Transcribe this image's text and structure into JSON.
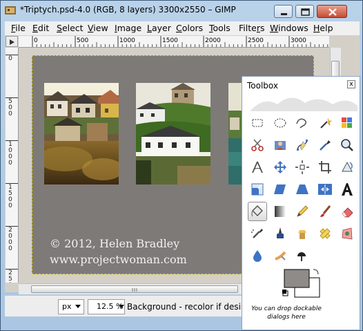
{
  "window": {
    "title": "*Triptych.psd-4.0 (RGB, 8 layers) 3300x2550 – GIMP",
    "buttons": [
      "minimize",
      "maximize",
      "close"
    ]
  },
  "menu": [
    {
      "label": "File",
      "accel": "F",
      "rest": "ile"
    },
    {
      "label": "Edit",
      "accel": "E",
      "rest": "dit"
    },
    {
      "label": "Select",
      "accel": "S",
      "rest": "elect"
    },
    {
      "label": "View",
      "accel": "V",
      "rest": "iew"
    },
    {
      "label": "Image",
      "accel": "I",
      "rest": "mage"
    },
    {
      "label": "Layer",
      "accel": "L",
      "rest": "ayer"
    },
    {
      "label": "Colors",
      "accel": "C",
      "rest": "olors"
    },
    {
      "label": "Tools",
      "accel": "T",
      "rest": "ools"
    },
    {
      "label": "Filters",
      "accel": "r",
      "pre": "Filte",
      "rest": "s"
    },
    {
      "label": "Windows",
      "accel": "W",
      "rest": "indows"
    },
    {
      "label": "Help",
      "accel": "H",
      "rest": "elp"
    }
  ],
  "rulers": {
    "horizontal": [
      "0",
      "500",
      "1000",
      "1500",
      "2000",
      "2500",
      "3000"
    ],
    "vertical": [
      "0",
      "500",
      "1000",
      "1500",
      "2000",
      "2500"
    ]
  },
  "canvas": {
    "caption_line1": "© 2012, Helen Bradley",
    "caption_line2": "www.projectwoman.com",
    "background": "#7e7a78",
    "photos": [
      "left-house-photo",
      "center-house-photo",
      "right-coast-photo"
    ]
  },
  "statusbar": {
    "unit": "px",
    "zoom": "12.5 %",
    "message": "Background - recolor if desired"
  },
  "toolbox": {
    "title": "Toolbox",
    "close_label": "x",
    "tools": [
      "rect-select-icon",
      "ellipse-select-icon",
      "free-select-icon",
      "fuzzy-select-icon",
      "select-by-color-icon",
      "scissors-icon",
      "foreground-select-icon",
      "paths-icon",
      "color-picker-icon",
      "zoom-icon",
      "measure-icon",
      "move-icon",
      "align-icon",
      "crop-icon",
      "rotate-icon",
      "scale-icon",
      "shear-icon",
      "perspective-icon",
      "flip-icon",
      "text-icon",
      "bucket-fill-icon",
      "blend-icon",
      "pencil-icon",
      "paintbrush-icon",
      "eraser-icon",
      "airbrush-icon",
      "ink-icon",
      "clone-icon",
      "heal-icon",
      "perspective-clone-icon",
      "blur-icon",
      "smudge-icon",
      "dodge-burn-icon"
    ],
    "active_tool": "bucket-fill-icon",
    "foreground_color": "#8e8b89",
    "background_color": "#ffffff",
    "dock_hint": "You can drop dockable dialogs here"
  }
}
